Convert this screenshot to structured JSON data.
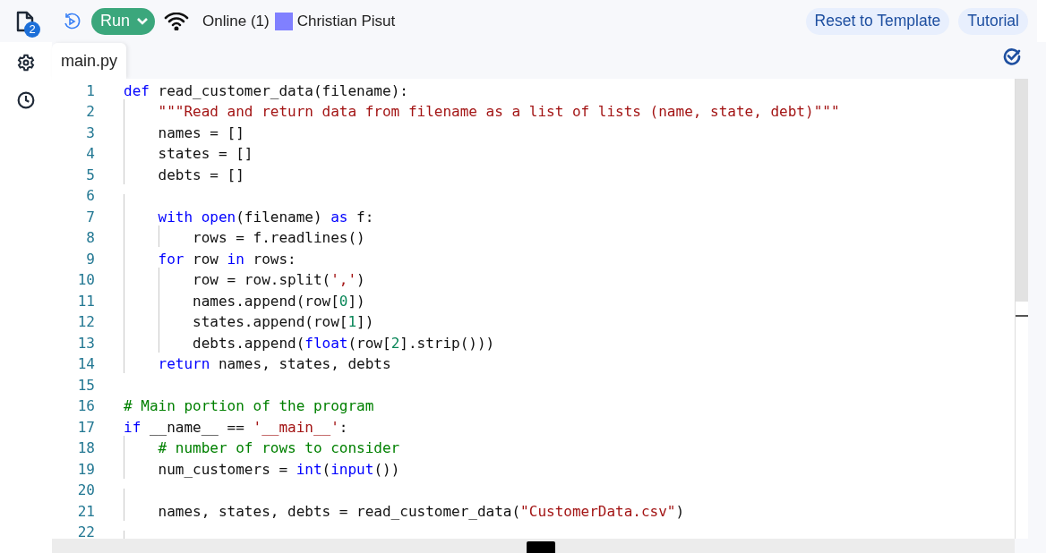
{
  "toolbar": {
    "files_badge": "2",
    "run_button": "Run",
    "online": "Online (1)",
    "user": {
      "name": "Christian Pisut",
      "color": "#8080ff"
    },
    "reset_button": "Reset to Template",
    "tutorial_button": "Tutorial"
  },
  "tabs": [
    {
      "label": "main.py",
      "selected": true
    }
  ],
  "editor": {
    "lines": [
      {
        "number": "1",
        "tokens": [
          {
            "kind": "kw",
            "text": "def"
          },
          {
            "kind": "plain",
            "text": " read_customer_data(filename):"
          }
        ]
      },
      {
        "number": "2",
        "tokens": [
          {
            "kind": "str",
            "text": "    \"\"\"Read and return data from filename as a list of lists (name, state, debt)\"\"\""
          }
        ]
      },
      {
        "number": "3",
        "tokens": [
          {
            "kind": "plain",
            "text": "    names = []"
          }
        ]
      },
      {
        "number": "4",
        "tokens": [
          {
            "kind": "plain",
            "text": "    states = []"
          }
        ]
      },
      {
        "number": "5",
        "tokens": [
          {
            "kind": "plain",
            "text": "    debts = []"
          }
        ]
      },
      {
        "number": "6"
      },
      {
        "number": "7",
        "tokens": [
          {
            "kind": "kw",
            "text": "    with open"
          },
          {
            "kind": "plain",
            "text": "(filename) "
          },
          {
            "kind": "kw",
            "text": "as"
          },
          {
            "kind": "plain",
            "text": " f:"
          }
        ]
      },
      {
        "number": "8",
        "tokens": [
          {
            "kind": "plain",
            "text": "        rows = f.readlines()"
          }
        ]
      },
      {
        "number": "9",
        "tokens": [
          {
            "kind": "kw",
            "text": "    for"
          },
          {
            "kind": "plain",
            "text": " row "
          },
          {
            "kind": "kw",
            "text": "in"
          },
          {
            "kind": "plain",
            "text": " rows:"
          }
        ]
      },
      {
        "number": "10",
        "tokens": [
          {
            "kind": "plain",
            "text": "        row = row.split("
          },
          {
            "kind": "str",
            "text": "','"
          },
          {
            "kind": "plain",
            "text": ")"
          }
        ]
      },
      {
        "number": "11",
        "tokens": [
          {
            "kind": "plain",
            "text": "        names.append(row["
          },
          {
            "kind": "num",
            "text": "0"
          },
          {
            "kind": "plain",
            "text": "])"
          }
        ]
      },
      {
        "number": "12",
        "tokens": [
          {
            "kind": "plain",
            "text": "        states.append(row["
          },
          {
            "kind": "num",
            "text": "1"
          },
          {
            "kind": "plain",
            "text": "])"
          }
        ]
      },
      {
        "number": "13",
        "tokens": [
          {
            "kind": "plain",
            "text": "        debts.append("
          },
          {
            "kind": "kw",
            "text": "float"
          },
          {
            "kind": "plain",
            "text": "(row["
          },
          {
            "kind": "num",
            "text": "2"
          },
          {
            "kind": "plain",
            "text": "].strip()))"
          }
        ]
      },
      {
        "number": "14",
        "tokens": [
          {
            "kind": "kw",
            "text": "    return"
          },
          {
            "kind": "plain",
            "text": " names, states, debts"
          }
        ]
      },
      {
        "number": "15"
      },
      {
        "number": "16",
        "tokens": [
          {
            "kind": "com",
            "text": "# Main portion of the program"
          }
        ]
      },
      {
        "number": "17",
        "tokens": [
          {
            "kind": "kw",
            "text": "if"
          },
          {
            "kind": "plain",
            "text": " __name__ == "
          },
          {
            "kind": "str",
            "text": "'__main__'"
          },
          {
            "kind": "plain",
            "text": ":"
          }
        ]
      },
      {
        "number": "18",
        "tokens": [
          {
            "kind": "com",
            "text": "    # number of rows to consider"
          }
        ]
      },
      {
        "number": "19",
        "tokens": [
          {
            "kind": "plain",
            "text": "    num_customers = "
          },
          {
            "kind": "kw",
            "text": "int"
          },
          {
            "kind": "plain",
            "text": "("
          },
          {
            "kind": "kw",
            "text": "input"
          },
          {
            "kind": "plain",
            "text": "())"
          }
        ]
      },
      {
        "number": "20"
      },
      {
        "number": "21",
        "tokens": [
          {
            "kind": "plain",
            "text": "    names, states, debts = read_customer_data("
          },
          {
            "kind": "str",
            "text": "\"CustomerData.csv\""
          },
          {
            "kind": "plain",
            "text": ")"
          }
        ]
      },
      {
        "number": "22"
      }
    ]
  }
}
